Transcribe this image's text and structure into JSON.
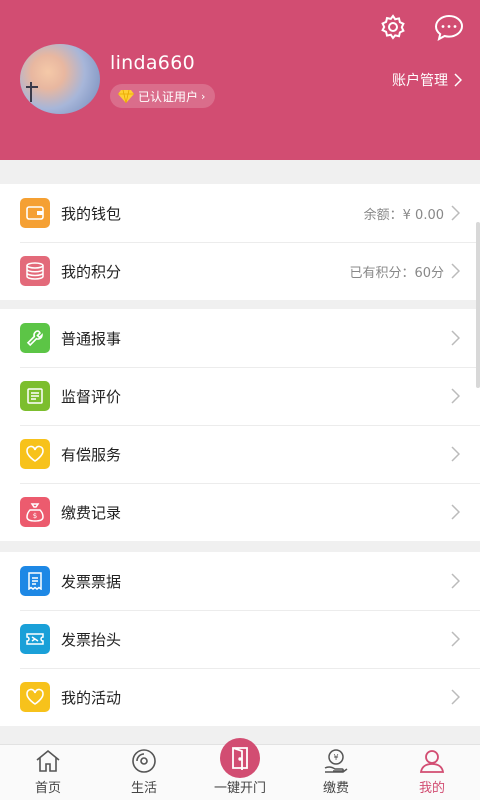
{
  "header": {
    "username": "linda660",
    "badge_label": "已认证用户",
    "account_label": "账户管理",
    "bg_color": "#d24d72"
  },
  "groups": [
    {
      "items": [
        {
          "label": "我的钱包",
          "value": "余额：¥ 0.00",
          "icon": "wallet-icon",
          "color": "#f5a033"
        },
        {
          "label": "我的积分",
          "value": "已有积分：60分",
          "icon": "coins-icon",
          "color": "#e36a7a"
        }
      ]
    },
    {
      "items": [
        {
          "label": "普通报事",
          "value": "",
          "icon": "wrench-icon",
          "color": "#5cc546"
        },
        {
          "label": "监督评价",
          "value": "",
          "icon": "note-icon",
          "color": "#7cbe2e"
        },
        {
          "label": "有偿服务",
          "value": "",
          "icon": "heart-icon",
          "color": "#f7c21b"
        },
        {
          "label": "缴费记录",
          "value": "",
          "icon": "money-bag-icon",
          "color": "#ec5b6e"
        }
      ]
    },
    {
      "items": [
        {
          "label": "发票票据",
          "value": "",
          "icon": "receipt-icon",
          "color": "#1e88e5"
        },
        {
          "label": "发票抬头",
          "value": "",
          "icon": "ticket-icon",
          "color": "#1aa0d8"
        },
        {
          "label": "我的活动",
          "value": "",
          "icon": "heart-icon",
          "color": "#f7c21b"
        }
      ]
    }
  ],
  "tabbar": {
    "tabs": [
      {
        "label": "首页",
        "icon": "home-icon",
        "active": false
      },
      {
        "label": "生活",
        "icon": "life-icon",
        "active": false
      },
      {
        "label": "一键开门",
        "icon": "door-icon",
        "active": false
      },
      {
        "label": "缴费",
        "icon": "payment-icon",
        "active": false
      },
      {
        "label": "我的",
        "icon": "user-icon",
        "active": true
      }
    ],
    "active_color": "#d24d72"
  }
}
